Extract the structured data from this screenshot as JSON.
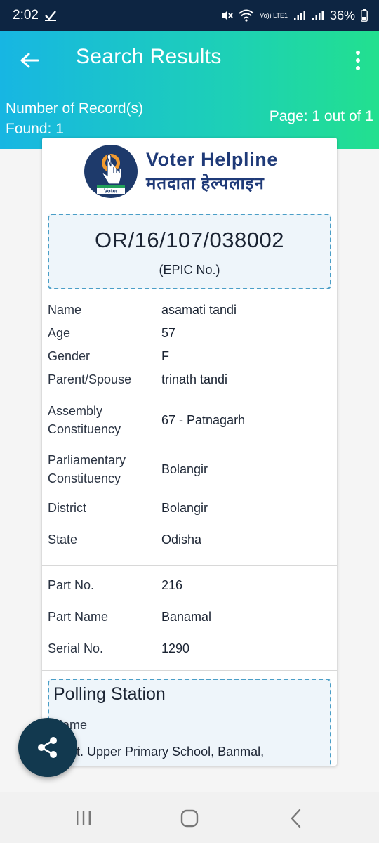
{
  "status_bar": {
    "time": "2:02",
    "battery": "36%",
    "network_label": "Vo)) LTE1"
  },
  "app_bar": {
    "title": "Search Results"
  },
  "summary": {
    "records_line1": "Number of Record(s)",
    "records_line2": "Found: 1",
    "page_info": "Page: 1 out of 1"
  },
  "logo": {
    "title_en": "Voter Helpline",
    "title_hi": "मतदाता हेल्पलाइन",
    "badge_text": "Voter"
  },
  "epic": {
    "number": "OR/16/107/038002",
    "label": "(EPIC No.)"
  },
  "details": [
    {
      "label": "Name",
      "value": "asamati tandi"
    },
    {
      "label": "Age",
      "value": "57"
    },
    {
      "label": "Gender",
      "value": "F"
    },
    {
      "label": "Parent/Spouse",
      "value": "trinath tandi"
    },
    {
      "label": "Assembly\nConstituency",
      "value": "67 - Patnagarh"
    },
    {
      "label": "Parliamentary\nConstituency",
      "value": "Bolangir"
    },
    {
      "label": "District",
      "value": "Bolangir"
    },
    {
      "label": "State",
      "value": "Odisha"
    }
  ],
  "part": [
    {
      "label": "Part No.",
      "value": "216"
    },
    {
      "label": "Part Name",
      "value": "Banamal"
    },
    {
      "label": "Serial No.",
      "value": "1290"
    }
  ],
  "polling_station": {
    "title": "Polling Station",
    "name_label": "Name",
    "name_value": "Govt. Upper Primary School, Banmal,"
  },
  "colors": {
    "status_bar": "#0d2542",
    "header_start": "#17b6e3",
    "header_end": "#22e08f",
    "fab": "#12394f",
    "dashed_border": "#4a9ec7",
    "logo_blue": "#1f3a78"
  },
  "icons": {
    "back": "arrow-left-icon",
    "more": "more-vertical-icon",
    "share": "share-icon",
    "nav_recents": "recents-icon",
    "nav_home": "home-icon",
    "nav_back": "nav-back-icon"
  }
}
